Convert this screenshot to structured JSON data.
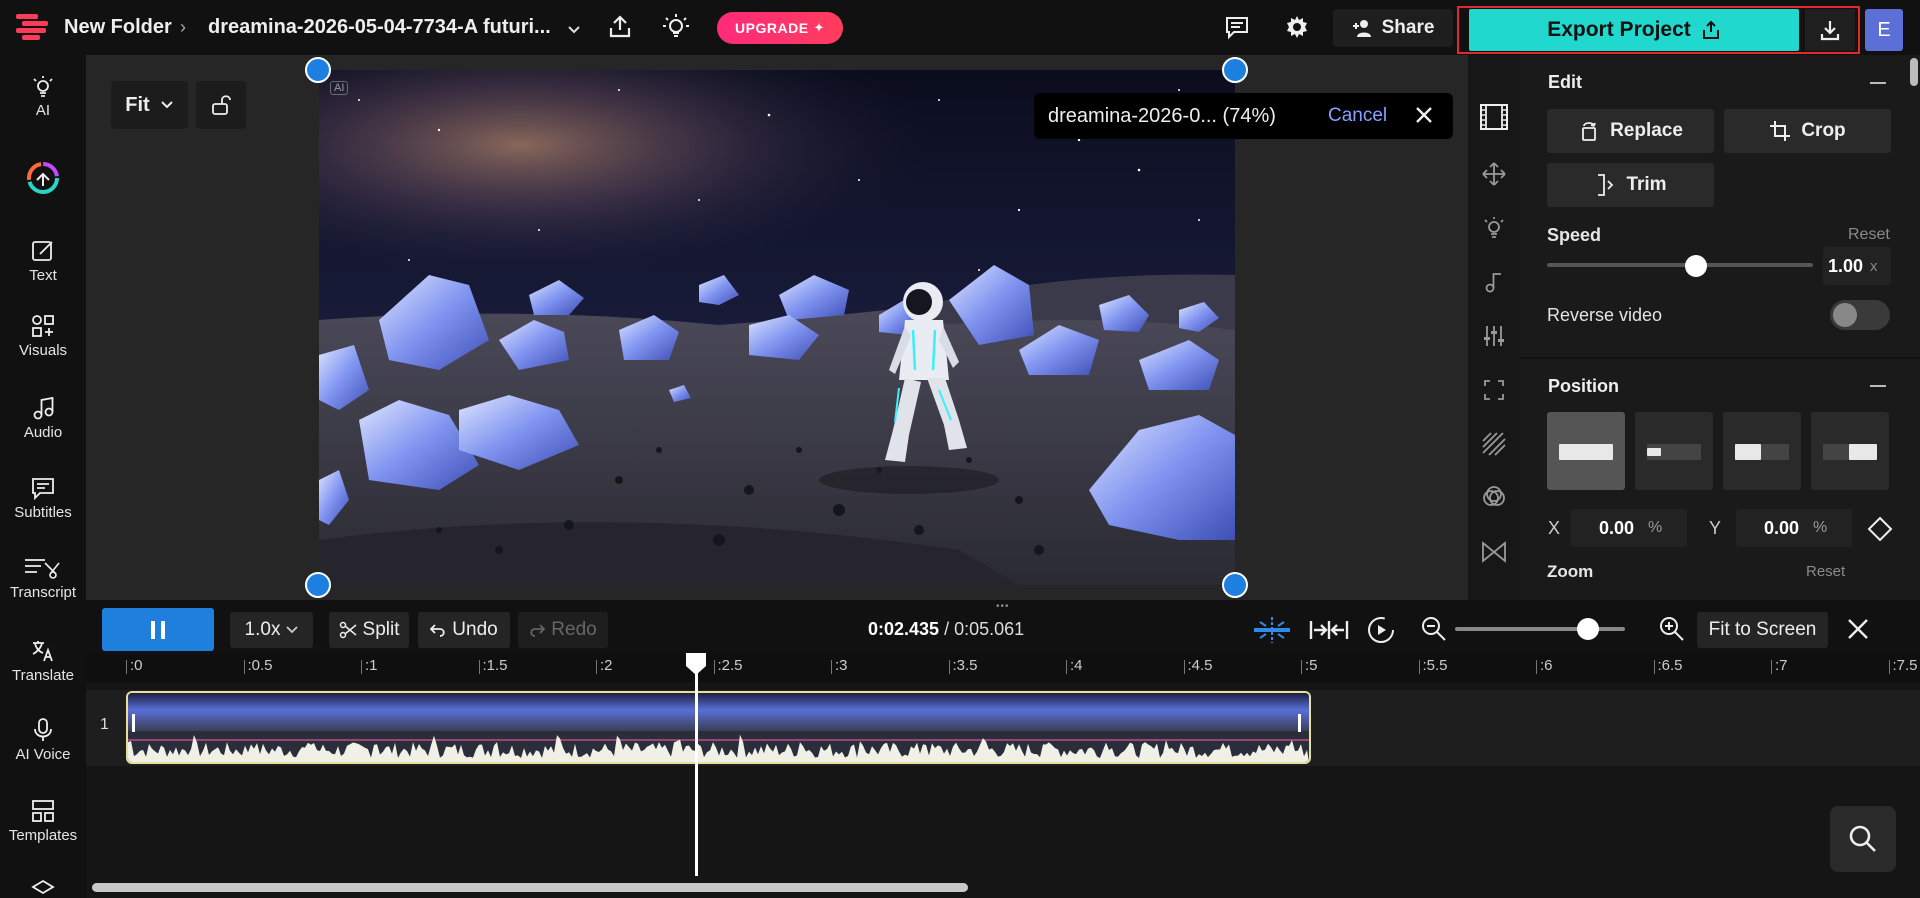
{
  "header": {
    "breadcrumb": "New Folder",
    "filename": "dreamina-2026-05-04-7734-A futuri...",
    "upgrade_label": "UPGRADE",
    "share_label": "Share",
    "export_label": "Export Project",
    "avatar_initial": "E"
  },
  "sidebar": {
    "items": [
      {
        "label": "AI"
      },
      {
        "label": ""
      },
      {
        "label": "Text"
      },
      {
        "label": "Visuals"
      },
      {
        "label": "Audio"
      },
      {
        "label": "Subtitles"
      },
      {
        "label": "Transcript"
      },
      {
        "label": "Translate"
      },
      {
        "label": "AI Voice"
      },
      {
        "label": "Templates"
      }
    ]
  },
  "canvas": {
    "fit_label": "Fit",
    "ai_badge": "AI",
    "toast": {
      "text": "dreamina-2026-0... (74%)",
      "cancel_label": "Cancel"
    }
  },
  "panel": {
    "edit": {
      "title": "Edit",
      "replace_label": "Replace",
      "crop_label": "Crop",
      "trim_label": "Trim"
    },
    "speed": {
      "label": "Speed",
      "reset_label": "Reset",
      "value": "1.00",
      "unit": "x",
      "slider_fraction": 0.56
    },
    "reverse_label": "Reverse video",
    "position": {
      "title": "Position",
      "x_label": "X",
      "x_value": "0.00",
      "y_label": "Y",
      "y_value": "0.00",
      "unit": "%"
    },
    "zoom": {
      "label": "Zoom",
      "reset_label": "Reset"
    }
  },
  "transport": {
    "speed_label": "1.0x",
    "split_label": "Split",
    "undo_label": "Undo",
    "redo_label": "Redo",
    "current_time": "0:02.435",
    "total_time": "/ 0:05.061",
    "fit_screen_label": "Fit to Screen",
    "zoom_fraction": 0.78
  },
  "timeline": {
    "track_number": "1",
    "ticks": [
      ":0",
      ":0.5",
      ":1",
      ":1.5",
      ":2",
      ":2.5",
      ":3",
      ":3.5",
      ":4",
      ":4.5",
      ":5",
      ":5.5",
      ":6",
      ":6.5",
      ":7",
      ":7.5"
    ]
  },
  "colors": {
    "accent_export": "#21d8cf",
    "play_button": "#1f7fdd",
    "upgrade": "#ff2a7a",
    "highlight_frame": "#e0282e"
  }
}
